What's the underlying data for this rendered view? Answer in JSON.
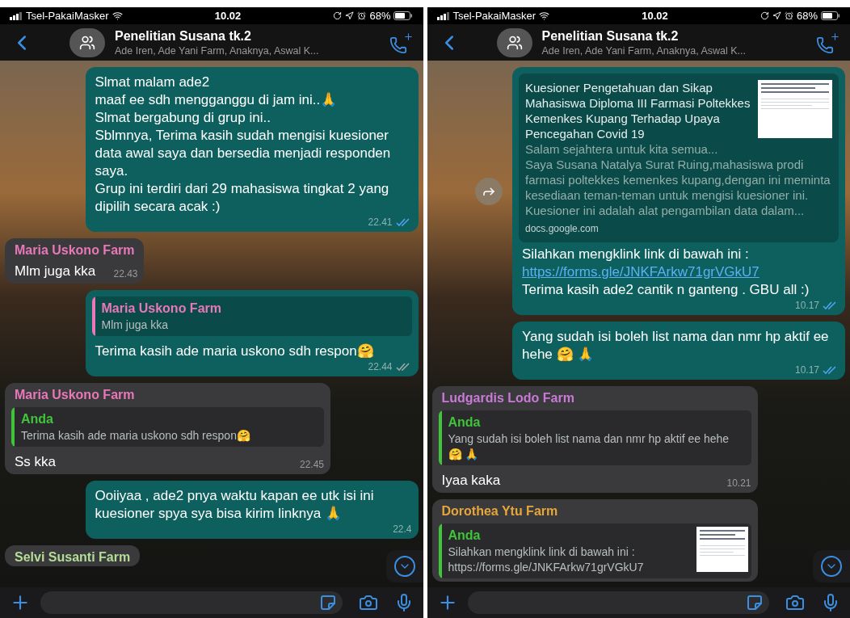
{
  "phones": [
    {
      "status_bar": {
        "carrier": "Tsel-PakaiMasker",
        "time": "10.02",
        "battery": "68%"
      },
      "header": {
        "title": "Penelitian Susana tk.2",
        "subtitle": "Ade Iren, Ade Yani Farm, Anaknya, Aswal K..."
      },
      "messages": [
        {
          "kind": "outgoing",
          "body": [
            {
              "kind": "text",
              "text": "Slmat malam ade2\nmaaf ee sdh mengganggu di jam ini..🙏\nSlmat bergabung di grup ini..\nSblmnya, Terima kasih sudah mengisi kuesioner data awal saya dan bersedia menjadi responden saya.\nGrup ini terdiri dari 29 mahasiswa tingkat 2 yang dipilih secara acak :)"
            }
          ],
          "time": "22.41",
          "read": true
        },
        {
          "kind": "incoming",
          "sender": "Maria Uskono Farm",
          "color": "#e878b8",
          "body": [
            {
              "kind": "text",
              "text": "Mlm juga kka"
            }
          ],
          "time": "22.43"
        },
        {
          "kind": "outgoing",
          "quote": {
            "author": "Maria Uskono Farm",
            "color": "#e878b8",
            "text": "Mlm juga kka"
          },
          "body": [
            {
              "kind": "text",
              "text": "Terima kasih ade maria uskono sdh respon🤗"
            }
          ],
          "time": "22.44",
          "read": false
        },
        {
          "kind": "incoming",
          "sender": "Maria Uskono Farm",
          "color": "#e878b8",
          "quote": {
            "author": "Anda",
            "color": "#3fc43a",
            "text": "Terima kasih ade maria uskono sdh respon🤗"
          },
          "body": [
            {
              "kind": "text",
              "text": "Ss kka"
            }
          ],
          "time": "22.45"
        },
        {
          "kind": "outgoing",
          "body": [
            {
              "kind": "text",
              "text": "Ooiiyaa , ade2 pnya waktu kapan ee utk isi ini kuesioner spya sya bisa kirim linknya 🙏"
            }
          ],
          "time": "22.4"
        },
        {
          "kind": "incoming",
          "sender": "Selvi Susanti Farm",
          "color": "#b4dd96"
        }
      ]
    },
    {
      "status_bar": {
        "carrier": "Tsel-PakaiMasker",
        "time": "10.02",
        "battery": "68%"
      },
      "header": {
        "title": "Penelitian Susana tk.2",
        "subtitle": "Ade Iren, Ade Yani Farm, Anaknya, Aswal K..."
      },
      "messages": [
        {
          "kind": "outgoing",
          "forward_button": true,
          "preview": {
            "title": "Kuesioner Pengetahuan dan Sikap Mahasiswa Diploma III Farmasi Poltekkes Kemenkes Kupang Terhadap Upaya Pencegahan Covid 19",
            "description": "Salam sejahtera untuk kita semua...\nSaya Susana Natalya Surat Ruing,mahasiswa prodi farmasi poltekkes kemenkes kupang,dengan ini meminta kesediaan teman-teman untuk mengisi kuesioner ini.\nKuesioner ini adalah alat pengambilan data dalam...",
            "domain": "docs.google.com"
          },
          "body": [
            {
              "kind": "text",
              "text": "Silahkan mengklink link di bawah ini :"
            },
            {
              "kind": "link",
              "text": "https://forms.gle/JNKFArkw71grVGkU7"
            },
            {
              "kind": "text",
              "text": "Terima kasih ade2 cantik n ganteng . GBU all :)"
            }
          ],
          "time": "10.17",
          "read": true
        },
        {
          "kind": "outgoing",
          "body": [
            {
              "kind": "text",
              "text": "Yang sudah isi boleh list nama dan nmr hp aktif ee hehe 🤗 🙏"
            }
          ],
          "time": "10.17",
          "read": true
        },
        {
          "kind": "incoming",
          "sender": "Ludgardis Lodo Farm",
          "color": "#c97ad6",
          "quote": {
            "author": "Anda",
            "color": "#3fc43a",
            "text": "Yang sudah isi boleh list nama dan nmr hp aktif ee hehe 🤗 🙏"
          },
          "body": [
            {
              "kind": "text",
              "text": "Iyaa kaka"
            }
          ],
          "time": "10.21"
        },
        {
          "kind": "incoming",
          "sender": "Dorothea Ytu Farm",
          "color": "#e6a63a",
          "quote": {
            "author": "Anda",
            "color": "#3fc43a",
            "thumbnail": true,
            "text": "Silahkan mengklink link di bawah ini :\nhttps://forms.gle/JNKFArkw71grVGkU7"
          }
        }
      ]
    }
  ]
}
